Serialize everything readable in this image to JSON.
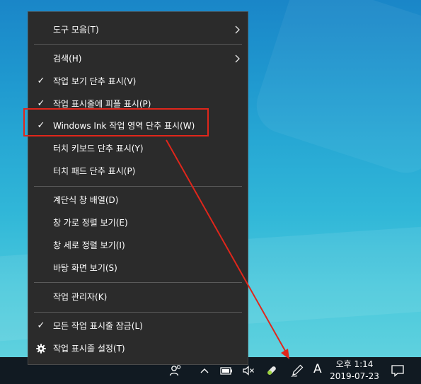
{
  "menu": {
    "toolbars": "도구 모음(T)",
    "search": "검색(H)",
    "show_task_view": "작업 보기 단추 표시(V)",
    "show_people": "작업 표시줄에 피플 표시(P)",
    "show_ink_workspace": "Windows Ink 작업 영역 단추 표시(W)",
    "show_touch_keyboard": "터치 키보드 단추 표시(Y)",
    "show_touchpad": "터치 패드 단추 표시(P)",
    "cascade": "계단식 창 배열(D)",
    "stacked": "창 가로 정렬 보기(E)",
    "side_by_side": "창 세로 정렬 보기(I)",
    "show_desktop": "바탕 화면 보기(S)",
    "task_manager": "작업 관리자(K)",
    "lock_taskbar": "모든 작업 표시줄 잠금(L)",
    "taskbar_settings": "작업 표시줄 설정(T)",
    "checkmark": "✓"
  },
  "taskbar": {
    "ime_indicator": "A",
    "time": "오후 1:14",
    "date": "2019-07-23"
  },
  "colors": {
    "menu_bg": "#2b2b2b",
    "taskbar_bg": "#111a22",
    "annotation": "#e0261b"
  }
}
